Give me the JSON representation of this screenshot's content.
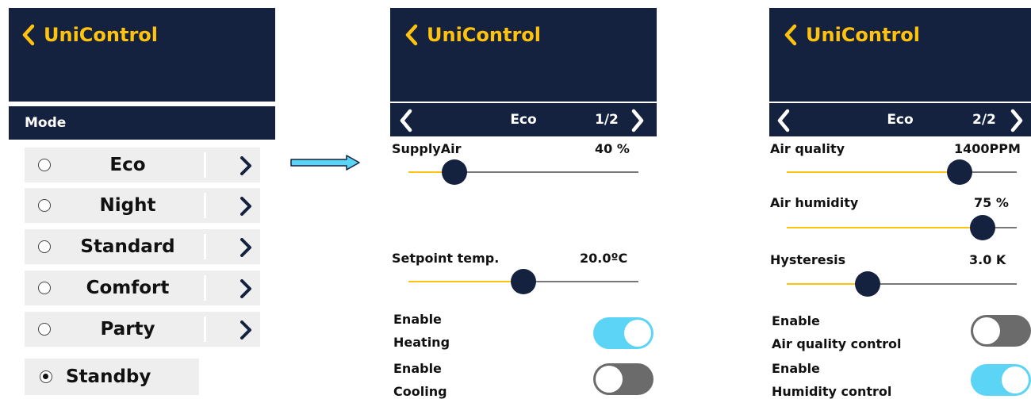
{
  "app": {
    "title": "UniControl",
    "back_icon": "chevron-left-icon",
    "accent": "#ffc20e",
    "header_bg": "#15223f"
  },
  "screen1": {
    "section_title": "Mode",
    "modes": [
      {
        "label": "Eco",
        "selected": false
      },
      {
        "label": "Night",
        "selected": false
      },
      {
        "label": "Standard",
        "selected": false
      },
      {
        "label": "Comfort",
        "selected": false
      },
      {
        "label": "Party",
        "selected": false
      }
    ],
    "standby": {
      "label": "Standby",
      "selected": true
    }
  },
  "screen2": {
    "mode": "Eco",
    "page": "1/2",
    "supply_air": {
      "label": "SupplyAir",
      "value_text": "40 %",
      "fraction": 0.2
    },
    "setpoint": {
      "label": "Setpoint temp.",
      "value_text": "20.0ºC",
      "fraction": 0.5
    },
    "heating": {
      "line1": "Enable",
      "line2": "Heating",
      "on": true
    },
    "cooling": {
      "line1": "Enable",
      "line2": "Cooling",
      "on": false
    }
  },
  "screen3": {
    "mode": "Eco",
    "page": "2/2",
    "air_quality": {
      "label": "Air quality",
      "value_text": "1400PPM",
      "fraction": 0.75
    },
    "air_humidity": {
      "label": "Air humidity",
      "value_text": "75 %",
      "fraction": 0.85
    },
    "hysteresis": {
      "label": "Hysteresis",
      "value_text": "3.0 K",
      "fraction": 0.35
    },
    "air_quality_control": {
      "line1": "Enable",
      "line2": "Air quality control",
      "on": false
    },
    "humidity_control": {
      "line1": "Enable",
      "line2": "Humidity control",
      "on": true
    }
  },
  "colors": {
    "toggle_on": "#5bd4f5",
    "toggle_off": "#6b6b6b",
    "slider_fill": "#ffc20e",
    "slider_rest": "#777777",
    "knob": "#15223f"
  }
}
